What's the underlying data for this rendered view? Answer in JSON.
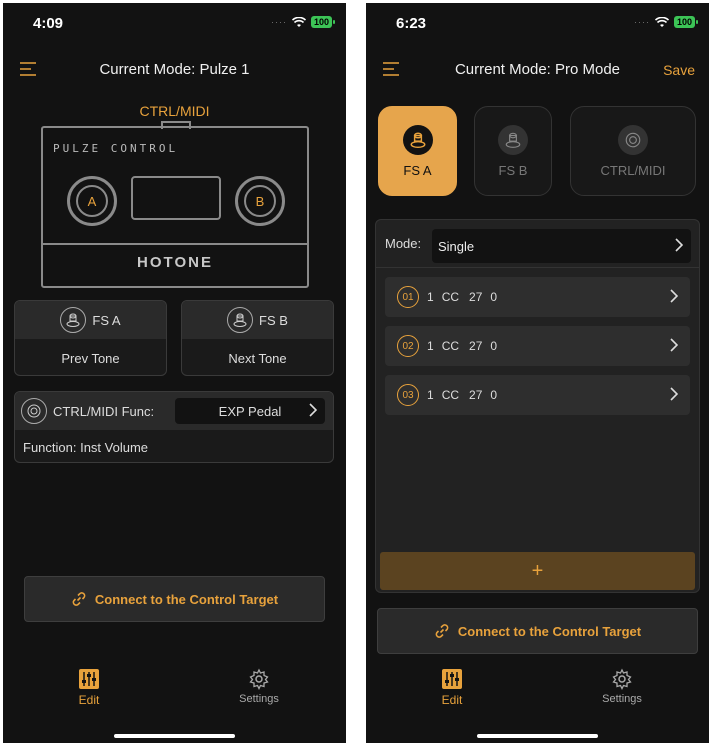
{
  "colors": {
    "accent": "#e8a23c",
    "background": "#121212",
    "battery": "#3cc456"
  },
  "left": {
    "status": {
      "time": "4:09",
      "battery": "100"
    },
    "nav": {
      "title": "Current Mode: Pulze 1"
    },
    "device": {
      "port_label": "CTRL/MIDI",
      "brand": "PULZE CONTROL",
      "knob_a": "A",
      "knob_b": "B",
      "logo": "HOTONE"
    },
    "fs_a": {
      "title": "FS A",
      "value": "Prev Tone"
    },
    "fs_b": {
      "title": "FS B",
      "value": "Next Tone"
    },
    "ctrl": {
      "label": "CTRL/MIDI Func:",
      "selected": "EXP Pedal",
      "function": "Function: Inst Volume"
    },
    "connect_label": "Connect to the Control Target",
    "tabs": [
      {
        "label": "Edit",
        "icon": "sliders-icon"
      },
      {
        "label": "Settings",
        "icon": "gear-icon"
      }
    ]
  },
  "right": {
    "status": {
      "time": "6:23",
      "battery": "100"
    },
    "nav": {
      "title": "Current Mode: Pro Mode",
      "save": "Save"
    },
    "tiles": [
      {
        "label": "FS A",
        "active": true
      },
      {
        "label": "FS B",
        "active": false
      },
      {
        "label": "CTRL/MIDI",
        "active": false
      }
    ],
    "mode": {
      "label": "Mode:",
      "value": "Single"
    },
    "messages": [
      {
        "num": "01",
        "channel": "1",
        "type": "CC",
        "number": "27",
        "value": "0"
      },
      {
        "num": "02",
        "channel": "1",
        "type": "CC",
        "number": "27",
        "value": "0"
      },
      {
        "num": "03",
        "channel": "1",
        "type": "CC",
        "number": "27",
        "value": "0"
      }
    ],
    "add_label": "+",
    "connect_label": "Connect to the Control Target",
    "tabs": [
      {
        "label": "Edit",
        "icon": "sliders-icon"
      },
      {
        "label": "Settings",
        "icon": "gear-icon"
      }
    ]
  }
}
